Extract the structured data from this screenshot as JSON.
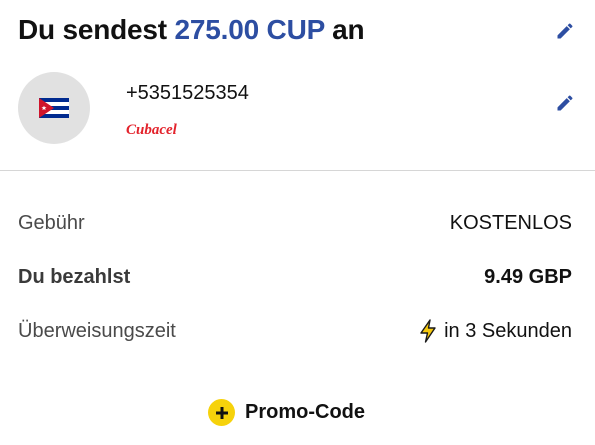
{
  "header": {
    "prefix": "Du sendest",
    "amount": "275.00 CUP",
    "suffix": "an"
  },
  "recipient": {
    "phone": "+5351525354",
    "operator": "Cubacel",
    "flag_icon": "cuba-flag-icon"
  },
  "summary": {
    "fee_label": "Gebühr",
    "fee_value": "KOSTENLOS",
    "pay_label": "Du bezahlst",
    "pay_value": "9.49 GBP",
    "time_label": "Überweisungszeit",
    "time_value": "in 3 Sekunden"
  },
  "promo": {
    "label": "Promo-Code"
  },
  "colors": {
    "accent": "#2d4ea2",
    "operator": "#e3232c",
    "promo": "#f6d20b"
  }
}
